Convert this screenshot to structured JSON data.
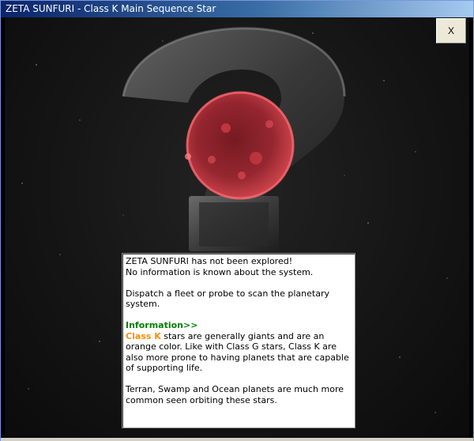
{
  "window": {
    "title": "ZETA SUNFURI - Class K Main Sequence Star",
    "close_label": "X"
  },
  "info": {
    "line1": "ZETA SUNFURI has not been explored!",
    "line2": "No information is known about the system.",
    "dispatch": "Dispatch a fleet or probe to scan the planetary system.",
    "heading": "Information>>",
    "class_label": "Class K",
    "class_text": " stars are generally giants and are an orange color. Like with Class G stars, Class K are also more prone to having planets that are capable of supporting life.",
    "planets_text": "Terran, Swamp and Ocean planets are much more common seen orbiting these stars."
  },
  "colors": {
    "heading": "#008000",
    "class_label": "#ff8c00",
    "star": "#c0303a"
  },
  "icons": {
    "background": "question-mark-icon",
    "star": "red-star-icon"
  }
}
